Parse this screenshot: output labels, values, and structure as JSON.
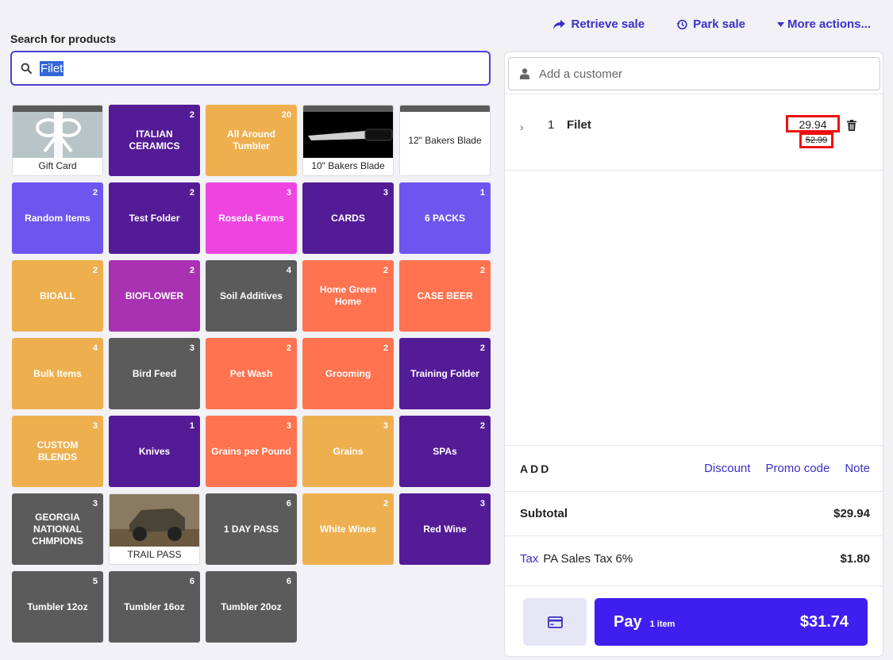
{
  "search": {
    "label": "Search for products",
    "value": "Filet"
  },
  "actions": {
    "retrieve": "Retrieve sale",
    "park": "Park sale",
    "more": "More actions..."
  },
  "tiles": [
    {
      "label": "Gift Card",
      "count": "",
      "color": "image"
    },
    {
      "label": "ITALIAN CERAMICS",
      "count": "2",
      "color": "#541b96"
    },
    {
      "label": "All Around Tumbler",
      "count": "20",
      "color": "#eeaf4f"
    },
    {
      "label": "10\" Bakers Blade",
      "count": "",
      "color": "image"
    },
    {
      "label": "12\" Bakers Blade",
      "count": "",
      "color": "#ffffff"
    },
    {
      "label": "Random Items",
      "count": "2",
      "color": "#6e55ee"
    },
    {
      "label": "Test Folder",
      "count": "2",
      "color": "#541b96"
    },
    {
      "label": "Roseda Farms",
      "count": "3",
      "color": "#ee44e0"
    },
    {
      "label": "CARDS",
      "count": "3",
      "color": "#541b96"
    },
    {
      "label": "6 PACKS",
      "count": "1",
      "color": "#6e55ee"
    },
    {
      "label": "BIOALL",
      "count": "2",
      "color": "#eeaf4f"
    },
    {
      "label": "BIOFLOWER",
      "count": "2",
      "color": "#a832b2"
    },
    {
      "label": "Soil Additives",
      "count": "4",
      "color": "#5b5b5b"
    },
    {
      "label": "Home Green Home",
      "count": "2",
      "color": "#ff7350"
    },
    {
      "label": "CASE BEER",
      "count": "2",
      "color": "#ff7350"
    },
    {
      "label": "Bulk Items",
      "count": "4",
      "color": "#eeaf4f"
    },
    {
      "label": "Bird Feed",
      "count": "3",
      "color": "#5b5b5b"
    },
    {
      "label": "Pet Wash",
      "count": "2",
      "color": "#ff7350"
    },
    {
      "label": "Grooming",
      "count": "2",
      "color": "#ff7350"
    },
    {
      "label": "Training Folder",
      "count": "2",
      "color": "#541b96"
    },
    {
      "label": "CUSTOM BLENDS",
      "count": "3",
      "color": "#eeaf4f"
    },
    {
      "label": "Knives",
      "count": "1",
      "color": "#541b96"
    },
    {
      "label": "Grains per Pound",
      "count": "3",
      "color": "#ff7350"
    },
    {
      "label": "Grains",
      "count": "3",
      "color": "#eeaf4f"
    },
    {
      "label": "SPAs",
      "count": "2",
      "color": "#541b96"
    },
    {
      "label": "GEORGIA NATIONAL CHMPIONS",
      "count": "3",
      "color": "#5b5b5b"
    },
    {
      "label": "TRAIL PASS",
      "count": "",
      "color": "image"
    },
    {
      "label": "1 DAY PASS",
      "count": "6",
      "color": "#5b5b5b"
    },
    {
      "label": "White Wines",
      "count": "2",
      "color": "#eeaf4f"
    },
    {
      "label": "Red Wine",
      "count": "3",
      "color": "#541b96"
    },
    {
      "label": "Tumbler 12oz",
      "count": "5",
      "color": "#5b5b5b"
    },
    {
      "label": "Tumbler 16oz",
      "count": "6",
      "color": "#5b5b5b"
    },
    {
      "label": "Tumbler 20oz",
      "count": "6",
      "color": "#5b5b5b"
    }
  ],
  "customer": {
    "placeholder": "Add a customer"
  },
  "line_item": {
    "qty": "1",
    "name": "Filet",
    "price": "29.94",
    "original_price": "52.99"
  },
  "summary": {
    "add_label": "ADD",
    "discount": "Discount",
    "promo": "Promo code",
    "note": "Note",
    "subtotal_label": "Subtotal",
    "subtotal": "$29.94",
    "tax_link": "Tax",
    "tax_label": "PA Sales Tax 6%",
    "tax": "$1.80"
  },
  "pay": {
    "label": "Pay",
    "items": "1 item",
    "total": "$31.74"
  },
  "colors": {
    "accent": "#3b2fc9",
    "pay": "#3f1ff0",
    "highlight": "#e11111"
  }
}
